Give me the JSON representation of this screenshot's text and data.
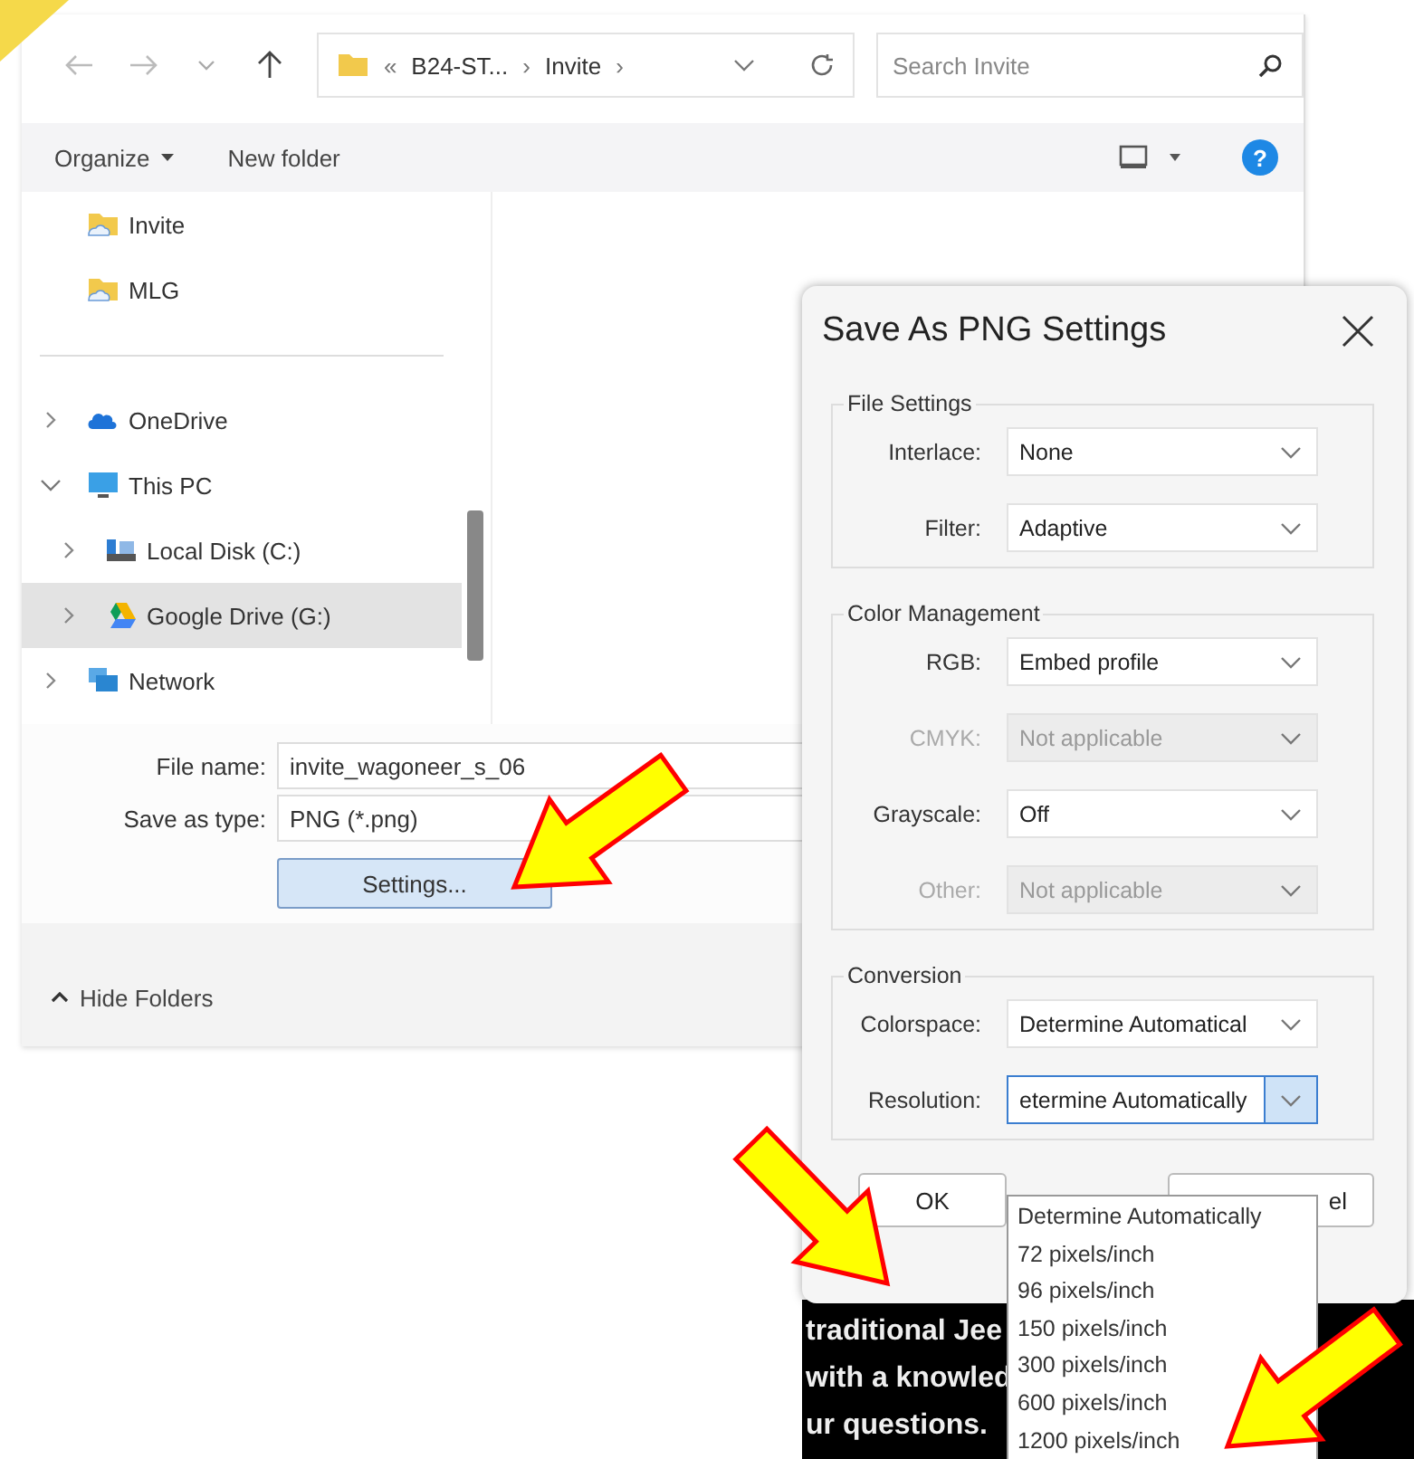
{
  "file_dialog": {
    "breadcrumb": [
      {
        "kind": "overflow",
        "text": "«"
      },
      {
        "kind": "folder",
        "text": "B24-ST..."
      },
      {
        "kind": "separator",
        "text": "›"
      },
      {
        "kind": "folder",
        "text": "Invite"
      },
      {
        "kind": "separator",
        "text": "›"
      }
    ],
    "search": {
      "placeholder": "Search Invite"
    },
    "toolbar": [
      {
        "kind": "menu",
        "label": "Organize"
      },
      {
        "kind": "button",
        "label": "New folder"
      }
    ],
    "help": "?",
    "sidebar": [
      {
        "kind": "folder",
        "label": "Invite",
        "selected": false
      },
      {
        "kind": "folder",
        "label": "MLG",
        "selected": false
      },
      {
        "kind": "divider"
      },
      {
        "kind": "cloud",
        "label": "OneDrive",
        "expanded": false,
        "selected": false
      },
      {
        "kind": "pc",
        "label": "This PC",
        "expanded": true,
        "selected": false,
        "children": [
          {
            "kind": "disk",
            "label": "Local Disk (C:)",
            "expanded": false,
            "selected": false
          },
          {
            "kind": "gdrive",
            "label": "Google Drive (G:)",
            "expanded": false,
            "selected": true
          }
        ]
      },
      {
        "kind": "network",
        "label": "Network",
        "expanded": false,
        "selected": false
      }
    ],
    "file_name": {
      "label": "File name:",
      "value": "invite_wagoneer_s_06"
    },
    "save_as_type": {
      "label": "Save as type:",
      "value": "PNG (*.png)"
    },
    "settings_button": "Settings...",
    "hide_folders": "Hide Folders"
  },
  "png_dialog": {
    "title": "Save As PNG Settings",
    "groups": [
      {
        "title": "File Settings",
        "rows": [
          {
            "label": "Interlace:",
            "value": "None",
            "disabled": false,
            "focused": false
          },
          {
            "label": "Filter:",
            "value": "Adaptive",
            "disabled": false,
            "focused": false
          }
        ]
      },
      {
        "title": "Color Management",
        "rows": [
          {
            "label": "RGB:",
            "value": "Embed profile",
            "disabled": false,
            "focused": false
          },
          {
            "label": "CMYK:",
            "value": "Not applicable",
            "disabled": true,
            "focused": false
          },
          {
            "label": "Grayscale:",
            "value": "Off",
            "disabled": false,
            "focused": false
          },
          {
            "label": "Other:",
            "value": "Not applicable",
            "disabled": true,
            "focused": false
          }
        ]
      },
      {
        "title": "Conversion",
        "rows": [
          {
            "label": "Colorspace:",
            "value": "Determine Automatical",
            "disabled": false,
            "focused": false
          },
          {
            "label": "Resolution:",
            "value": "etermine Automatically",
            "disabled": false,
            "focused": true
          }
        ]
      }
    ],
    "ok_button": "OK",
    "cancel_button": "el"
  },
  "dropdown": [
    "Determine Automatically",
    "72 pixels/inch",
    "96 pixels/inch",
    "150 pixels/inch",
    "300 pixels/inch",
    "600 pixels/inch",
    "1200 pixels/inch"
  ],
  "background_text": [
    "traditional Jee",
    "with a knowled",
    "ur questions."
  ]
}
